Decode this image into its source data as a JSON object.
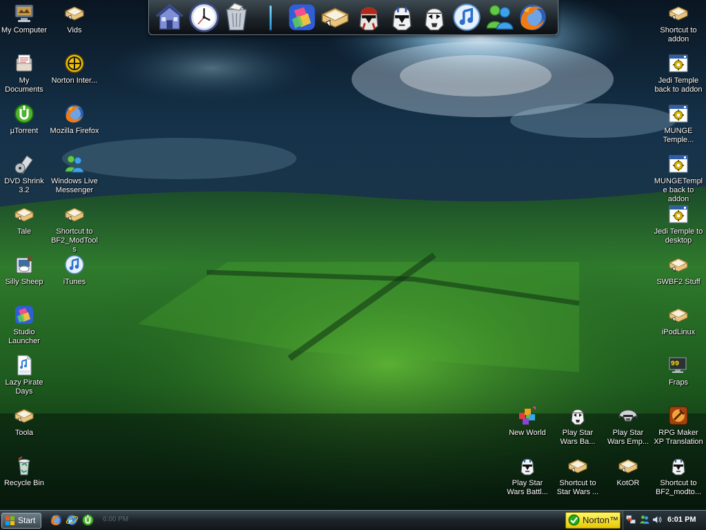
{
  "desktop": {
    "left_column_1": [
      {
        "label": "My Computer",
        "icon": "my-computer-icon"
      },
      {
        "label": "My Documents",
        "icon": "my-documents-icon"
      },
      {
        "label": "µTorrent",
        "icon": "utorrent-icon"
      },
      {
        "label": "DVD Shrink 3.2",
        "icon": "dvd-shrink-icon"
      },
      {
        "label": "Tale",
        "icon": "shortcut-folder-icon"
      },
      {
        "label": "Silly Sheep",
        "icon": "silly-sheep-icon"
      },
      {
        "label": "Studio Launcher",
        "icon": "studio-launcher-icon"
      },
      {
        "label": "Lazy Pirate Days",
        "icon": "mp3-file-icon"
      },
      {
        "label": "Toola",
        "icon": "shortcut-folder-icon"
      },
      {
        "label": "Recycle Bin",
        "icon": "recycle-bin-icon"
      }
    ],
    "left_column_2": [
      {
        "label": "Vids",
        "icon": "shortcut-folder-icon"
      },
      {
        "label": "Norton Inter...",
        "icon": "norton-icon"
      },
      {
        "label": "Mozilla Firefox",
        "icon": "firefox-icon"
      },
      {
        "label": "Windows Live Messenger",
        "icon": "messenger-icon"
      },
      {
        "label": "Shortcut to BF2_ModTools",
        "icon": "shortcut-folder-icon"
      },
      {
        "label": "iTunes",
        "icon": "itunes-icon"
      }
    ],
    "right_column": [
      {
        "label": "Shortcut to addon",
        "icon": "shortcut-folder-icon"
      },
      {
        "label": "Jedi Temple back to addon",
        "icon": "batch-file-icon"
      },
      {
        "label": "MUNGE Temple...",
        "icon": "batch-file-icon"
      },
      {
        "label": "MUNGETemple back to addon",
        "icon": "batch-file-icon"
      },
      {
        "label": "Jedi Temple to desktop",
        "icon": "batch-file-icon"
      },
      {
        "label": "SWBF2 Stuff",
        "icon": "shortcut-folder-icon"
      },
      {
        "label": "iPodLinux",
        "icon": "shortcut-folder-icon"
      },
      {
        "label": "Fraps",
        "icon": "fraps-icon"
      }
    ],
    "bottom_row_1": [
      {
        "label": "New World",
        "icon": "new-world-icon"
      },
      {
        "label": "Play Star Wars Ba...",
        "icon": "stormtrooper-icon"
      },
      {
        "label": "Play Star Wars Emp...",
        "icon": "helmet-icon"
      },
      {
        "label": "RPG Maker XP Translation",
        "icon": "rpg-maker-icon"
      }
    ],
    "bottom_row_2": [
      {
        "label": "Play Star Wars Battl...",
        "icon": "clone-trooper-icon"
      },
      {
        "label": "Shortcut to Star Wars ...",
        "icon": "shortcut-folder-icon"
      },
      {
        "label": "KotOR",
        "icon": "shortcut-folder-icon"
      },
      {
        "label": "Shortcut to BF2_modto...",
        "icon": "clone-trooper-icon"
      }
    ]
  },
  "dock": {
    "items": [
      {
        "icon": "home-icon"
      },
      {
        "icon": "clock-icon"
      },
      {
        "icon": "trash-icon"
      },
      {
        "icon": "studio-launcher-icon"
      },
      {
        "icon": "shortcut-folder-icon"
      },
      {
        "icon": "red-clone-trooper-icon"
      },
      {
        "icon": "clone-trooper-icon"
      },
      {
        "icon": "stormtrooper-icon"
      },
      {
        "icon": "itunes-icon"
      },
      {
        "icon": "messenger-icon"
      },
      {
        "icon": "firefox-icon"
      }
    ]
  },
  "taskbar": {
    "start_label": "Start",
    "ghost_time": "6:00 PM",
    "norton_label": "Norton™",
    "clock": "6:01 PM",
    "quick_launch": [
      {
        "icon": "firefox-icon"
      },
      {
        "icon": "ie-icon"
      },
      {
        "icon": "utorrent-icon"
      }
    ],
    "tray": [
      {
        "icon": "network-icon"
      },
      {
        "icon": "messenger-icon"
      },
      {
        "icon": "volume-icon"
      }
    ]
  },
  "colors": {
    "label_text": "#ffffff",
    "norton_yellow": "#f1d80a",
    "taskbar": "#1e262b"
  }
}
